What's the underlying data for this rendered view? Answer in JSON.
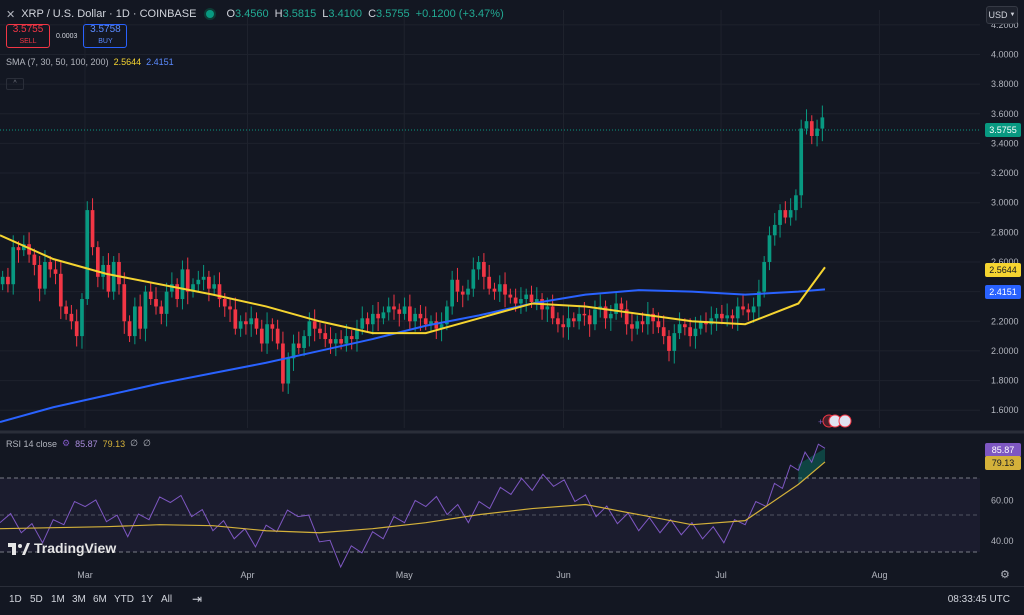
{
  "header": {
    "symbol": "XRP / U.S. Dollar · 1D · COINBASE",
    "o_label": "O",
    "o": "3.4560",
    "h_label": "H",
    "h": "3.5815",
    "l_label": "L",
    "l": "3.4100",
    "c_label": "C",
    "c": "3.5755",
    "change": "+0.1200 (+3.47%)"
  },
  "trade": {
    "sell_price": "3.5755",
    "sell_label": "SELL",
    "spread": "0.0003",
    "buy_price": "3.5758",
    "buy_label": "BUY"
  },
  "sma_legend": {
    "name": "SMA (7, 30, 50, 100, 200)",
    "v1": "2.5644",
    "v2": "2.4151"
  },
  "rsi_legend": {
    "name": "RSI 14 close",
    "v1": "85.87",
    "v2": "79.13",
    "e1": "∅",
    "e2": "∅"
  },
  "currency": "USD",
  "price_labels": {
    "last": "3.5755",
    "sma_fast": "2.5644",
    "sma_slow": "2.4151",
    "rsi": "85.87",
    "rsi_ma": "79.13"
  },
  "timeframes": [
    "1D",
    "5D",
    "1M",
    "3M",
    "6M",
    "YTD",
    "1Y",
    "All"
  ],
  "clock": "08:33:45 UTC",
  "brand": "TradingView",
  "colors": {
    "bg": "#131722",
    "up": "#089981",
    "down": "#f23645",
    "sma_fast": "#f5d430",
    "sma_slow": "#2962ff",
    "rsi": "#7e57c2",
    "rsi_ma": "#d4b13a"
  },
  "chart_data": [
    {
      "type": "candlestick",
      "title": "XRP / U.S. Dollar · 1D · COINBASE",
      "x_ticks": [
        "Mar",
        "Apr",
        "May",
        "Jun",
        "Jul",
        "Aug"
      ],
      "y_ticks": [
        1.6,
        1.8,
        2.0,
        2.2,
        2.4,
        2.6,
        2.8,
        3.0,
        3.2,
        3.4,
        3.6,
        3.8,
        4.0,
        4.2
      ],
      "ylim": [
        1.48,
        4.3
      ],
      "closes": [
        2.5,
        2.45,
        2.7,
        2.68,
        2.72,
        2.65,
        2.58,
        2.42,
        2.6,
        2.55,
        2.52,
        2.3,
        2.25,
        2.2,
        2.1,
        2.35,
        2.95,
        2.7,
        2.5,
        2.58,
        2.4,
        2.6,
        2.45,
        2.2,
        2.1,
        2.3,
        2.15,
        2.4,
        2.35,
        2.3,
        2.25,
        2.4,
        2.45,
        2.35,
        2.55,
        2.4,
        2.45,
        2.48,
        2.5,
        2.42,
        2.45,
        2.35,
        2.3,
        2.28,
        2.15,
        2.2,
        2.18,
        2.22,
        2.15,
        2.05,
        2.18,
        2.15,
        2.05,
        1.78,
        1.95,
        2.05,
        2.02,
        2.1,
        2.2,
        2.15,
        2.12,
        2.08,
        2.05,
        2.08,
        2.05,
        2.1,
        2.08,
        2.15,
        2.22,
        2.18,
        2.25,
        2.22,
        2.26,
        2.3,
        2.28,
        2.25,
        2.3,
        2.2,
        2.25,
        2.22,
        2.18,
        2.2,
        2.15,
        2.18,
        2.3,
        2.48,
        2.4,
        2.38,
        2.42,
        2.55,
        2.6,
        2.5,
        2.42,
        2.4,
        2.45,
        2.38,
        2.36,
        2.32,
        2.35,
        2.38,
        2.33,
        2.35,
        2.28,
        2.3,
        2.22,
        2.18,
        2.16,
        2.22,
        2.2,
        2.25,
        2.24,
        2.18,
        2.28,
        2.3,
        2.22,
        2.25,
        2.32,
        2.28,
        2.18,
        2.15,
        2.2,
        2.18,
        2.25,
        2.2,
        2.16,
        2.1,
        2.0,
        2.12,
        2.18,
        2.16,
        2.1,
        2.15,
        2.2,
        2.18,
        2.22,
        2.25,
        2.22,
        2.24,
        2.22,
        2.3,
        2.28,
        2.26,
        2.3,
        2.4,
        2.6,
        2.78,
        2.85,
        2.95,
        2.9,
        2.95,
        3.05,
        3.5,
        3.55,
        3.45,
        3.5,
        3.5755
      ],
      "series": [
        {
          "name": "SMA fast",
          "value": "2.5644",
          "color": "#f5d430",
          "x": [
            0,
            10,
            20,
            30,
            40,
            50,
            60,
            70,
            80,
            90,
            100,
            110,
            120,
            130,
            140,
            150,
            155
          ],
          "y": [
            2.78,
            2.62,
            2.52,
            2.45,
            2.38,
            2.3,
            2.2,
            2.12,
            2.12,
            2.22,
            2.32,
            2.3,
            2.25,
            2.2,
            2.18,
            2.32,
            2.5644
          ]
        },
        {
          "name": "SMA slow",
          "value": "2.4151",
          "color": "#2962ff",
          "x": [
            0,
            10,
            20,
            30,
            40,
            50,
            60,
            70,
            80,
            90,
            100,
            110,
            120,
            130,
            140,
            150,
            155
          ],
          "y": [
            1.52,
            1.62,
            1.7,
            1.78,
            1.85,
            1.92,
            2.0,
            2.08,
            2.17,
            2.24,
            2.32,
            2.38,
            2.41,
            2.4,
            2.38,
            2.4,
            2.4151
          ]
        }
      ]
    },
    {
      "type": "line",
      "title": "RSI 14 close",
      "y_ticks": [
        40.0,
        60.0
      ],
      "ylim": [
        28,
        90
      ],
      "bands": [
        70,
        50,
        30
      ],
      "series": [
        {
          "name": "RSI",
          "value": "85.87",
          "color": "#7e57c2",
          "x": [
            0,
            8,
            16,
            24,
            32,
            40,
            48,
            56,
            64,
            72,
            80,
            88,
            96,
            104,
            112,
            120,
            128,
            136,
            144,
            150,
            155
          ],
          "y": [
            52,
            42,
            60,
            45,
            62,
            48,
            40,
            55,
            30,
            44,
            60,
            52,
            66,
            70,
            55,
            48,
            46,
            42,
            60,
            78,
            85.87
          ]
        },
        {
          "name": "RSI MA",
          "value": "79.13",
          "color": "#d4b13a",
          "x": [
            0,
            10,
            20,
            30,
            40,
            50,
            60,
            70,
            80,
            90,
            100,
            110,
            120,
            130,
            140,
            150,
            155
          ],
          "y": [
            46,
            46.5,
            47,
            48,
            47.5,
            45,
            44,
            46,
            49,
            53,
            56,
            58,
            53,
            48,
            50,
            68,
            79.13
          ]
        }
      ]
    }
  ]
}
